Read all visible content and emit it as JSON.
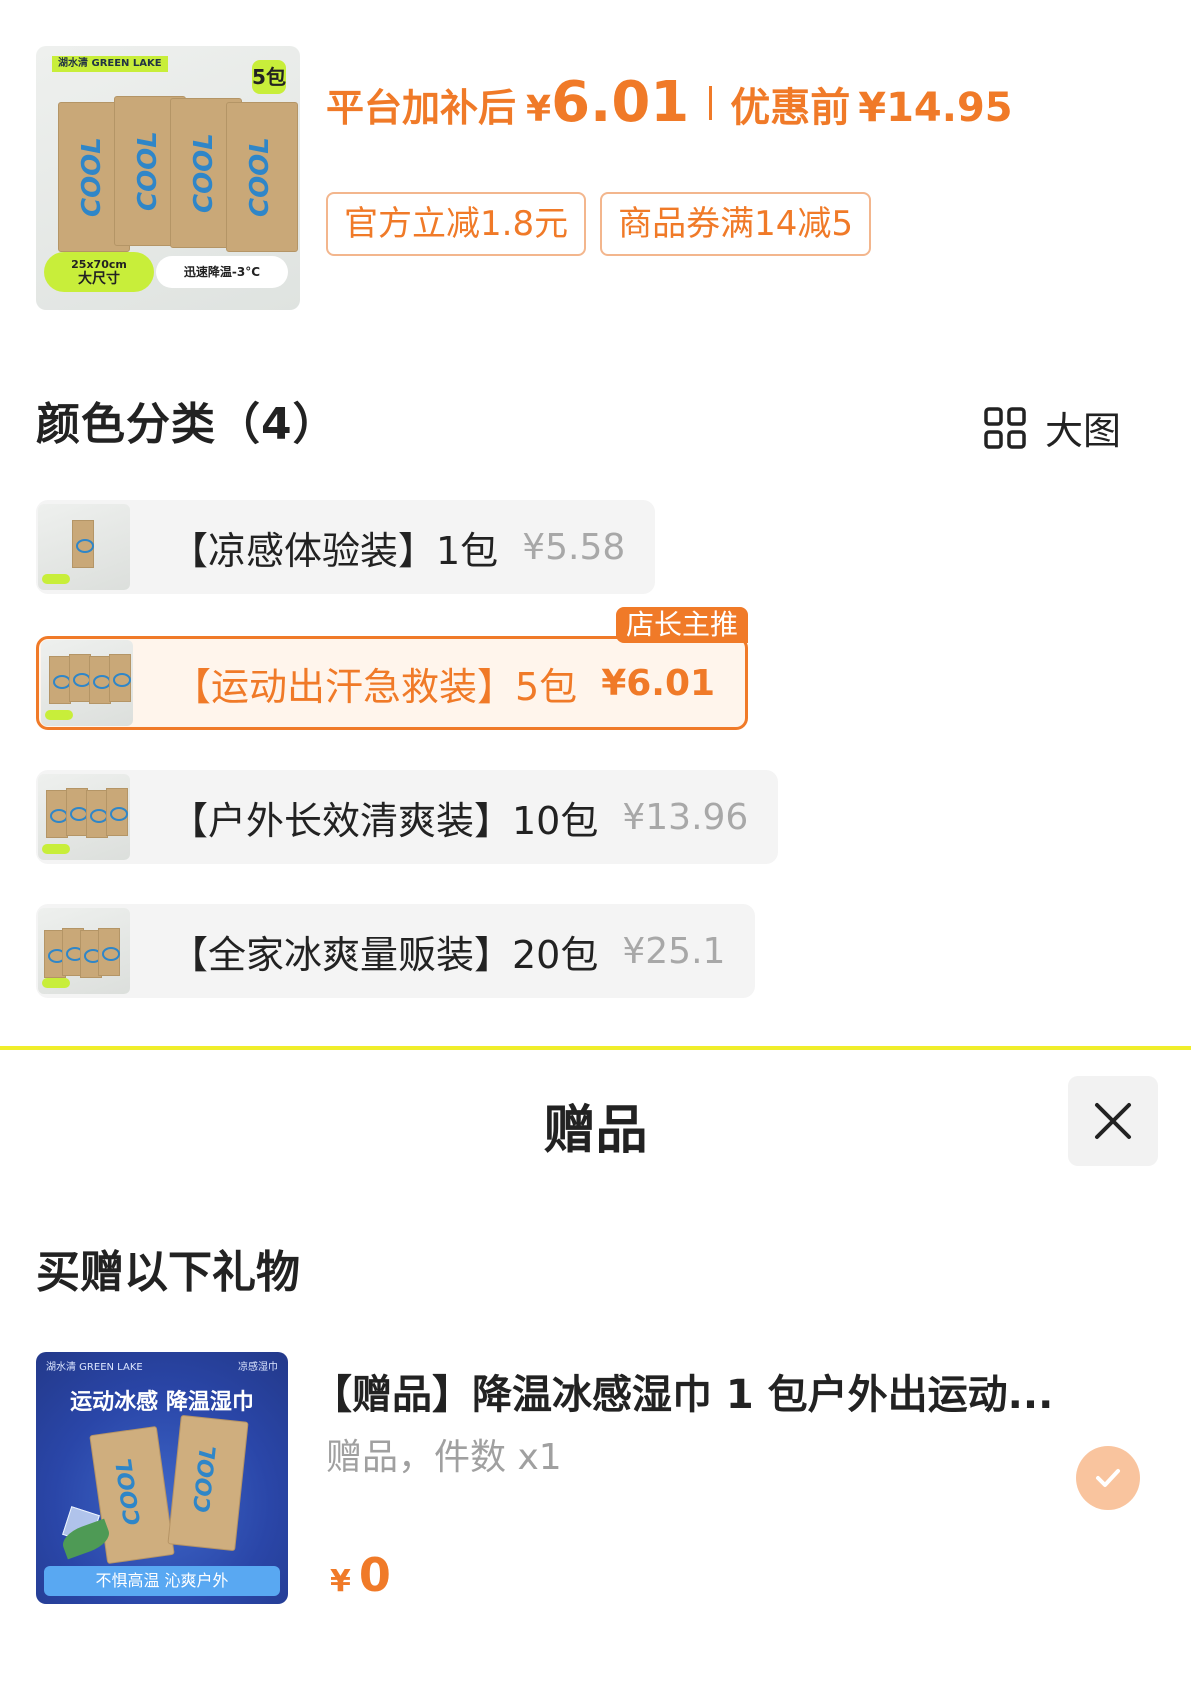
{
  "product": {
    "image": {
      "brand": "湖水清 GREEN LAKE",
      "count_badge": "5包",
      "size_label_1": "25x70cm",
      "size_label_2": "大尺寸",
      "cool_label": "迅速降温-3°C"
    },
    "price_after_label": "平台加补后",
    "currency": "¥",
    "price_after": "6.01",
    "price_before_label": "优惠前",
    "price_before": "¥14.95",
    "coupons": [
      "官方立减1.8元",
      "商品券满14减5"
    ]
  },
  "options": {
    "title": "颜色分类（4）",
    "big_view_label": "大图",
    "items": [
      {
        "name": "【凉感体验装】1包",
        "price": "¥5.58",
        "selected": false
      },
      {
        "name": "【运动出汗急救装】5包",
        "price": "¥6.01",
        "selected": true,
        "tag": "店长主推"
      },
      {
        "name": "【户外长效清爽装】10包",
        "price": "¥13.96",
        "selected": false
      },
      {
        "name": "【全家冰爽量贩装】20包",
        "price": "¥25.1",
        "selected": false
      }
    ]
  },
  "gift_sheet": {
    "title": "赠品",
    "section_label": "买赠以下礼物",
    "gift": {
      "image": {
        "brand_left": "湖水清 GREEN LAKE",
        "brand_right": "凉感湿巾",
        "title": "运动冰感 降温湿巾",
        "footer": "不惧高温 沁爽户外"
      },
      "name": "【赠品】降温冰感湿巾 1 包户外出运动...",
      "subtitle": "赠品，件数 x1",
      "currency": "¥",
      "price": "0"
    }
  },
  "colors": {
    "accent": "#f07a28",
    "coupon_border": "#f3b68d",
    "option_bg": "#f4f4f4",
    "muted": "#a8a8a8",
    "divider": "#f0ee2a"
  },
  "icons": {
    "big_view": "grid-icon",
    "close": "close-icon",
    "selected": "check-icon"
  }
}
